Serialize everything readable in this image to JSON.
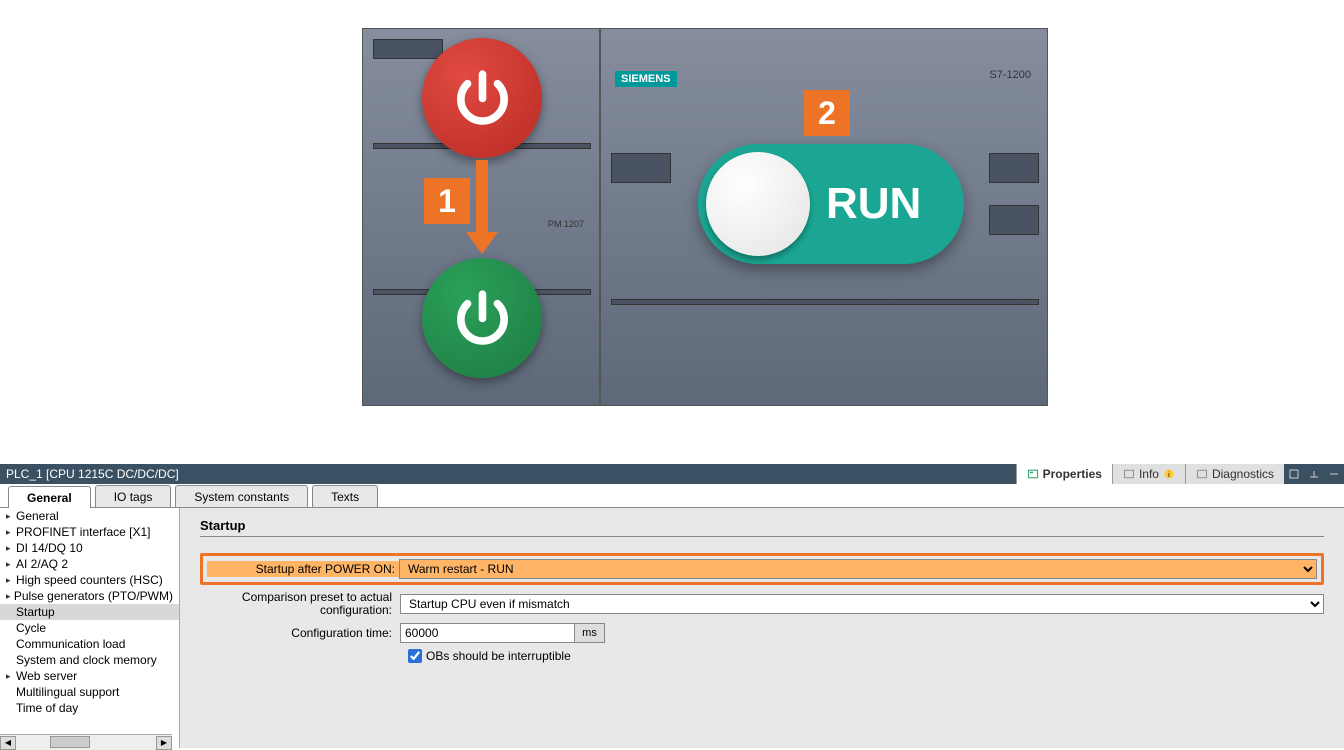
{
  "device": {
    "siemens_label": "SIEMENS",
    "pm_model": "PM 1207",
    "cpu_model": "S7-1200",
    "badge1": "1",
    "badge2": "2",
    "run_label": "RUN"
  },
  "titlebar": {
    "title": "PLC_1 [CPU 1215C DC/DC/DC]",
    "right_tabs": {
      "properties": "Properties",
      "info": "Info",
      "diagnostics": "Diagnostics"
    }
  },
  "tabs": {
    "general": "General",
    "io_tags": "IO tags",
    "system_constants": "System constants",
    "texts": "Texts"
  },
  "tree": [
    {
      "label": "General",
      "exp": "▸"
    },
    {
      "label": "PROFINET interface [X1]",
      "exp": "▸"
    },
    {
      "label": "DI 14/DQ 10",
      "exp": "▸"
    },
    {
      "label": "AI 2/AQ 2",
      "exp": "▸"
    },
    {
      "label": "High speed counters (HSC)",
      "exp": "▸"
    },
    {
      "label": "Pulse generators (PTO/PWM)",
      "exp": "▸"
    },
    {
      "label": "Startup",
      "exp": "",
      "sel": true
    },
    {
      "label": "Cycle",
      "exp": ""
    },
    {
      "label": "Communication load",
      "exp": ""
    },
    {
      "label": "System and clock memory",
      "exp": ""
    },
    {
      "label": "Web server",
      "exp": "▸"
    },
    {
      "label": "Multilingual support",
      "exp": ""
    },
    {
      "label": "Time of day",
      "exp": ""
    }
  ],
  "form": {
    "section": "Startup",
    "startup_after_power_on": {
      "label": "Startup after POWER ON:",
      "value": "Warm restart - RUN"
    },
    "comparison": {
      "label": "Comparison preset to actual configuration:",
      "value": "Startup CPU even if mismatch"
    },
    "config_time": {
      "label": "Configuration time:",
      "value": "60000",
      "unit": "ms"
    },
    "interruptible": {
      "label": "OBs should be interruptible",
      "checked": true
    }
  }
}
